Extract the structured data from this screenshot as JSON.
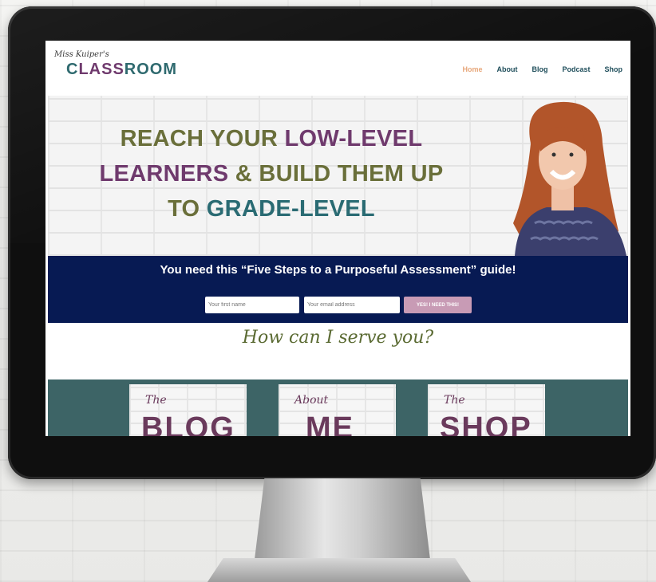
{
  "brand": {
    "script": "Miss Kuiper's",
    "name_part1": "C",
    "name_part2": "LASS",
    "name_part3": "ROOM",
    "colors": {
      "teal": "#2a6b73",
      "plum": "#6f3a6d",
      "olive": "#6a6f3a",
      "navy": "#071a53"
    }
  },
  "nav": {
    "items": [
      "Home",
      "About",
      "Blog",
      "Podcast",
      "Shop"
    ],
    "active": "Home"
  },
  "hero": {
    "line1_a": "REACH YOUR ",
    "line1_b": "LOW-LEVEL",
    "line2_a": "LEARNERS",
    "line2_b": " & BUILD THEM UP",
    "line3_a": "TO ",
    "line3_b": "GRADE-LEVEL"
  },
  "optin": {
    "title": "You need this “Five Steps to a Purposeful Assessment” guide!",
    "first_name_placeholder": "Your first name",
    "email_placeholder": "Your email address",
    "button": "YES! I NEED THIS!"
  },
  "serve": {
    "heading": "How can I serve you?"
  },
  "cards": [
    {
      "small": "The",
      "big_a": "BLOG",
      "big_b": ""
    },
    {
      "small": "About",
      "big_a": "ME",
      "big_b": ""
    },
    {
      "small": "The",
      "big_a": "S",
      "big_b": "HOP"
    }
  ]
}
